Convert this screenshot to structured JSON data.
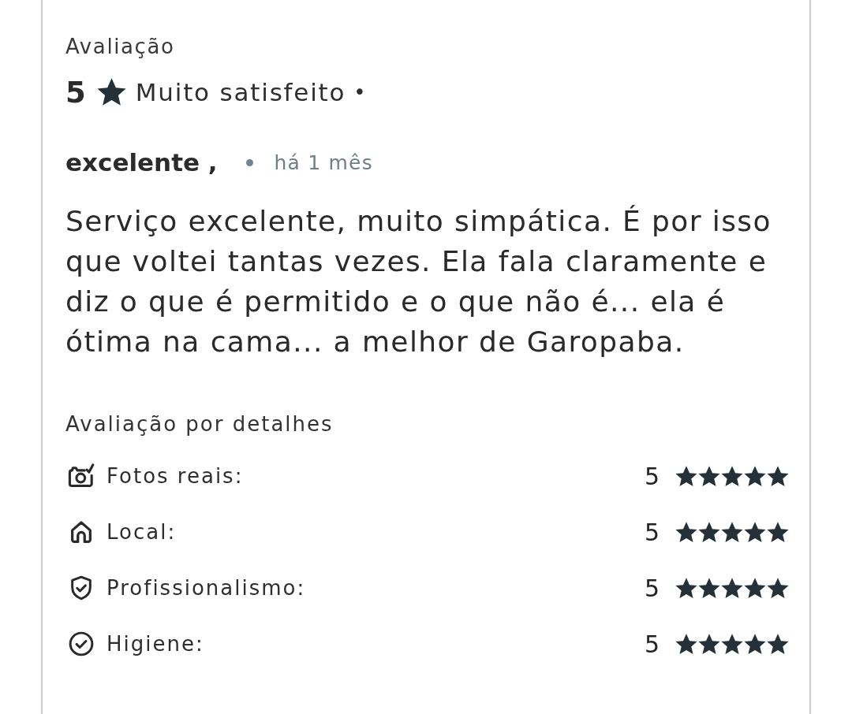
{
  "review": {
    "heading": "Avaliação",
    "score": "5",
    "rating_label": "Muito satisfeito",
    "separator": "•",
    "title": "excelente ,",
    "time": "há 1 mês",
    "body": "Serviço excelente, muito simpática. É por isso que voltei tantas vezes. Ela fala claramente e diz o que é permitido e o que não é... ela é ótima na cama... a melhor de Garopaba.",
    "details": {
      "heading": "Avaliação por detalhes",
      "items": [
        {
          "kind": "camera",
          "label": "Fotos reais:",
          "score": "5",
          "stars": 5
        },
        {
          "kind": "house",
          "label": "Local:",
          "score": "5",
          "stars": 5
        },
        {
          "kind": "shield",
          "label": "Profissionalismo:",
          "score": "5",
          "stars": 5
        },
        {
          "kind": "check",
          "label": "Higiene:",
          "score": "5",
          "stars": 5
        }
      ]
    }
  }
}
